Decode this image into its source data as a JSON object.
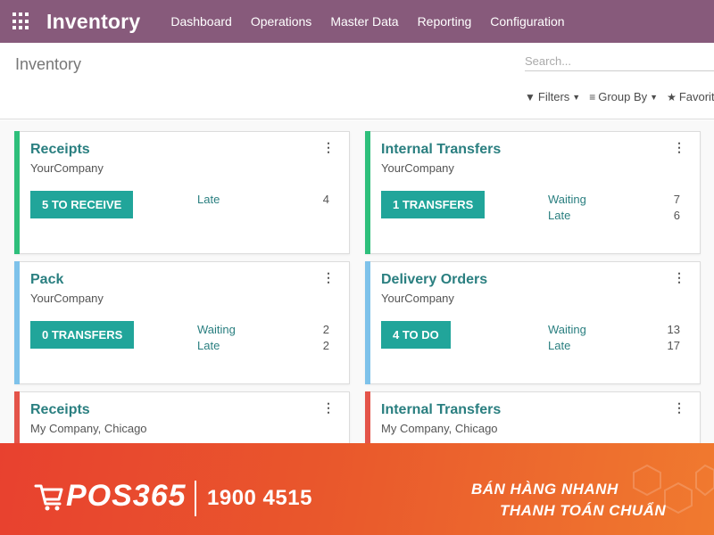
{
  "navbar": {
    "app_title": "Inventory",
    "menu": [
      "Dashboard",
      "Operations",
      "Master Data",
      "Reporting",
      "Configuration"
    ]
  },
  "control_panel": {
    "breadcrumb": "Inventory",
    "search_placeholder": "Search...",
    "filters_label": "Filters",
    "group_by_label": "Group By",
    "favorites_label": "Favorites"
  },
  "cards": [
    {
      "title": "Receipts",
      "company": "YourCompany",
      "button": "5 TO RECEIVE",
      "color": "#2ebf7b",
      "stats": [
        {
          "label": "Late",
          "value": "4"
        }
      ]
    },
    {
      "title": "Internal Transfers",
      "company": "YourCompany",
      "button": "1 TRANSFERS",
      "color": "#2ebf7b",
      "stats": [
        {
          "label": "Waiting",
          "value": "7"
        },
        {
          "label": "Late",
          "value": "6"
        }
      ]
    },
    {
      "title": "Pack",
      "company": "YourCompany",
      "button": "0 TRANSFERS",
      "color": "#7ec2ea",
      "stats": [
        {
          "label": "Waiting",
          "value": "2"
        },
        {
          "label": "Late",
          "value": "2"
        }
      ]
    },
    {
      "title": "Delivery Orders",
      "company": "YourCompany",
      "button": "4 TO DO",
      "color": "#7ec2ea",
      "stats": [
        {
          "label": "Waiting",
          "value": "13"
        },
        {
          "label": "Late",
          "value": "17"
        }
      ]
    },
    {
      "title": "Receipts",
      "company": "My Company, Chicago",
      "color": "#e4544a"
    },
    {
      "title": "Internal Transfers",
      "company": "My Company, Chicago",
      "color": "#e4544a"
    }
  ],
  "banner": {
    "brand": "POS365",
    "phone": "1900 4515",
    "slogan_line1": "BÁN HÀNG NHANH",
    "slogan_line2": "THANH TOÁN CHUẨN"
  },
  "icons": {
    "apps": "apps-grid-icon",
    "filter": "funnel-icon",
    "group_by": "list-icon",
    "favorites": "star-icon",
    "card_menu": "kebab-icon",
    "cart": "cart-icon"
  }
}
